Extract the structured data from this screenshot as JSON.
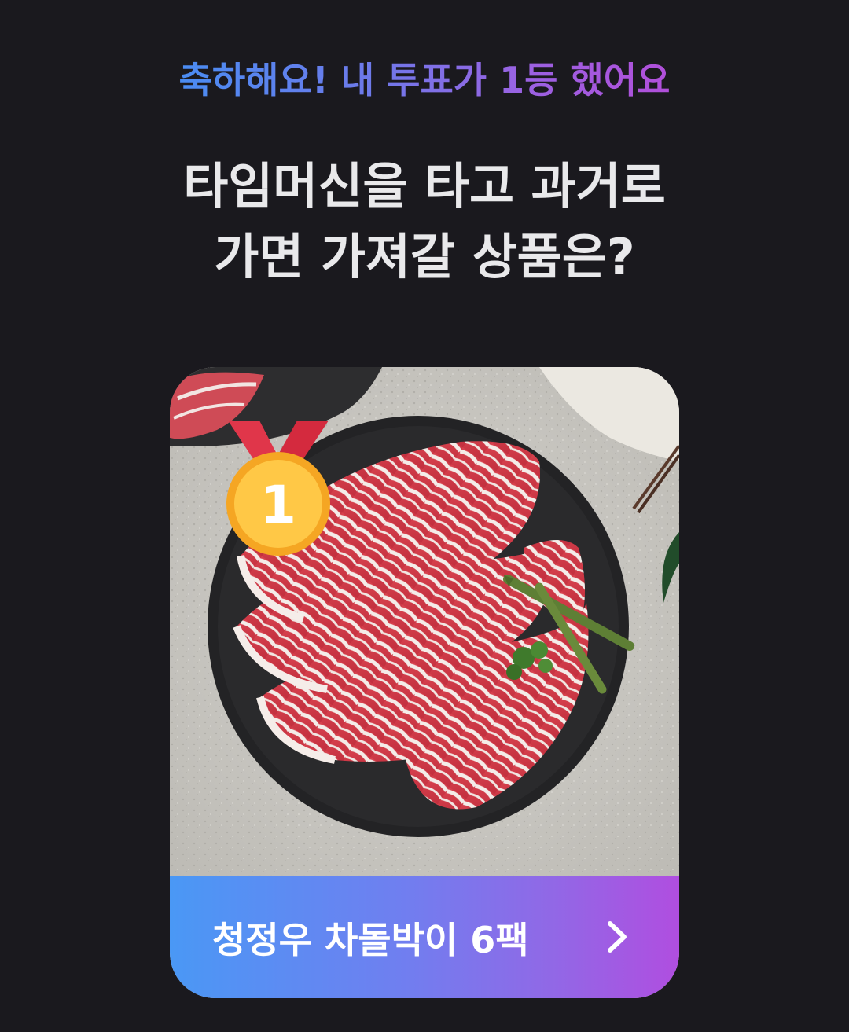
{
  "header": {
    "congrats_text": "축하해요! 내 투표가 1등 했어요",
    "gradient_from": "#4a8cf2",
    "gradient_to": "#b14fda"
  },
  "question": {
    "line1": "타임머신을 타고 과거로",
    "line2": "가면 가져갈 상품은?"
  },
  "winner": {
    "rank": "1",
    "rank_badge_icon": "gold-medal-icon",
    "product_name": "청정우 차돌박이 6팩",
    "arrow_icon": "chevron-right-icon"
  },
  "colors": {
    "background": "#1a191e",
    "question_text": "#e9e9eb",
    "bar_from": "#4a98f5",
    "bar_to": "#b04ee0"
  }
}
